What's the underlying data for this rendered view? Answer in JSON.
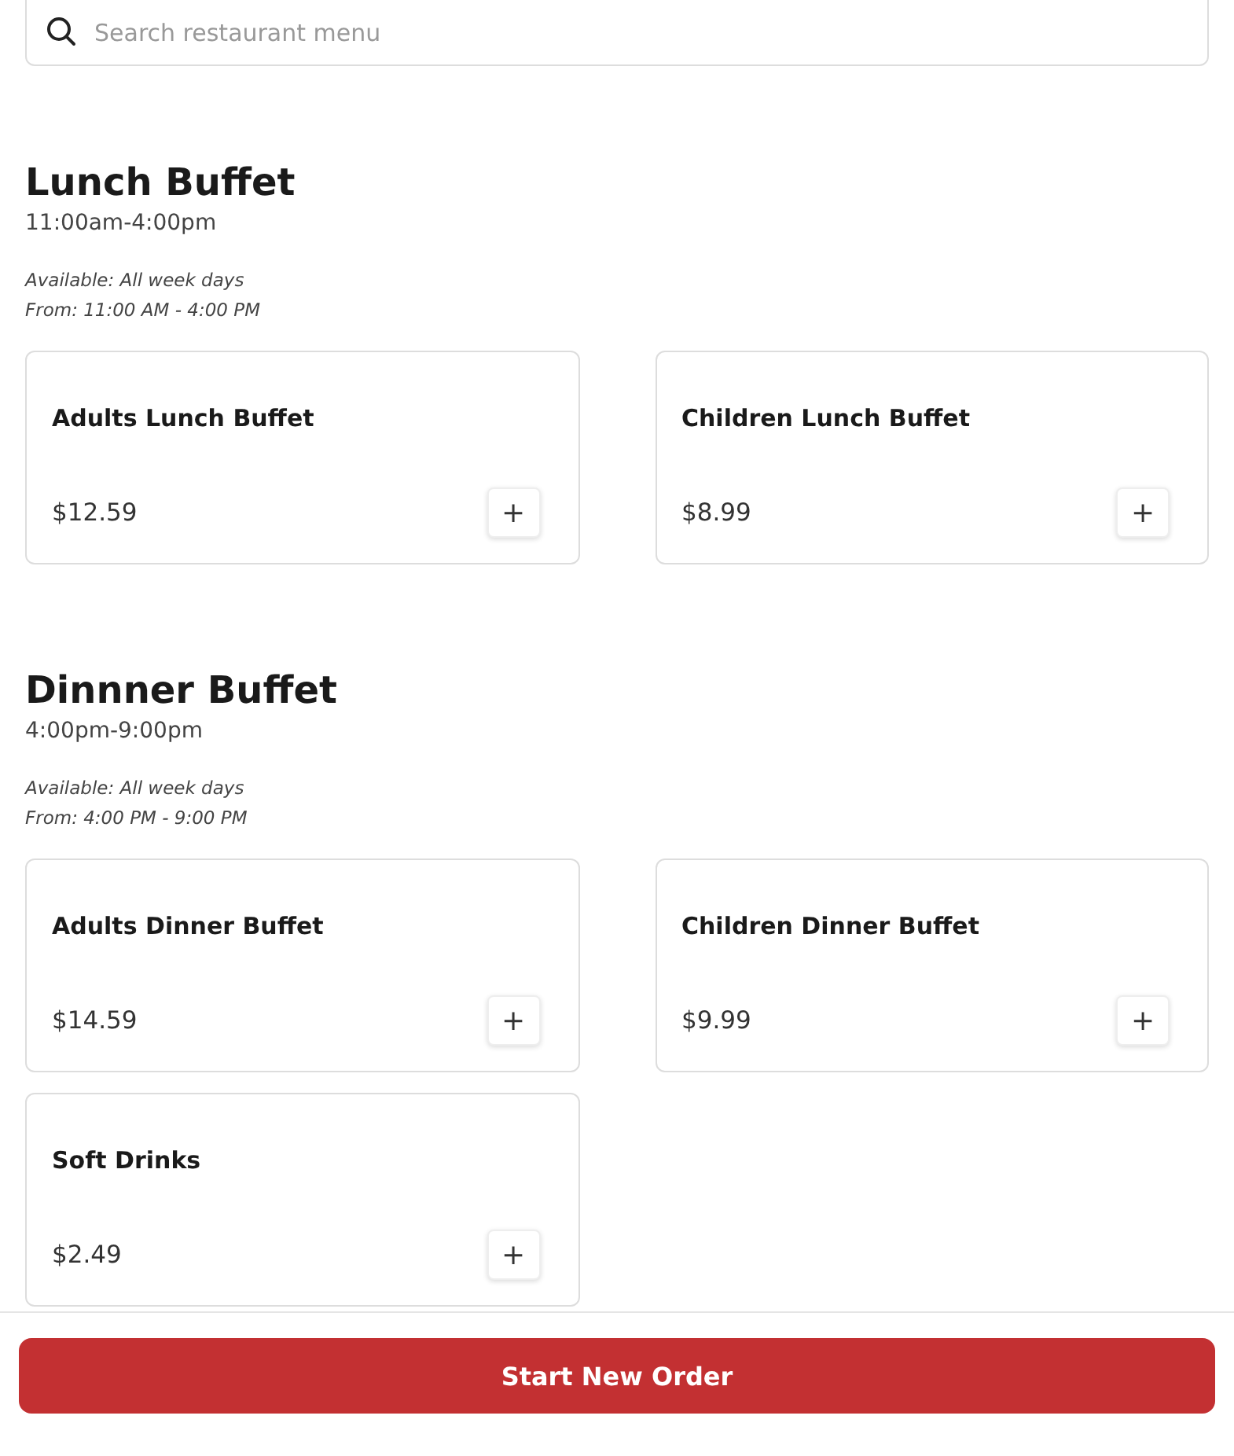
{
  "search": {
    "placeholder": "Search restaurant menu"
  },
  "sections": [
    {
      "title": "Lunch Buffet",
      "hours": "11:00am-4:00pm",
      "availability": "Available: All week days",
      "from": "From: 11:00 AM - 4:00 PM",
      "items": [
        {
          "name": "Adults Lunch Buffet",
          "price": "$12.59",
          "add": "+"
        },
        {
          "name": "Children Lunch Buffet",
          "price": "$8.99",
          "add": "+"
        }
      ]
    },
    {
      "title": "Dinnner Buffet",
      "hours": "4:00pm-9:00pm",
      "availability": "Available: All week days",
      "from": "From: 4:00 PM - 9:00 PM",
      "items": [
        {
          "name": "Adults Dinner Buffet",
          "price": "$14.59",
          "add": "+"
        },
        {
          "name": "Children Dinner Buffet",
          "price": "$9.99",
          "add": "+"
        },
        {
          "name": "Soft Drinks",
          "price": "$2.49",
          "add": "+"
        }
      ]
    }
  ],
  "order_button": "Start New Order"
}
